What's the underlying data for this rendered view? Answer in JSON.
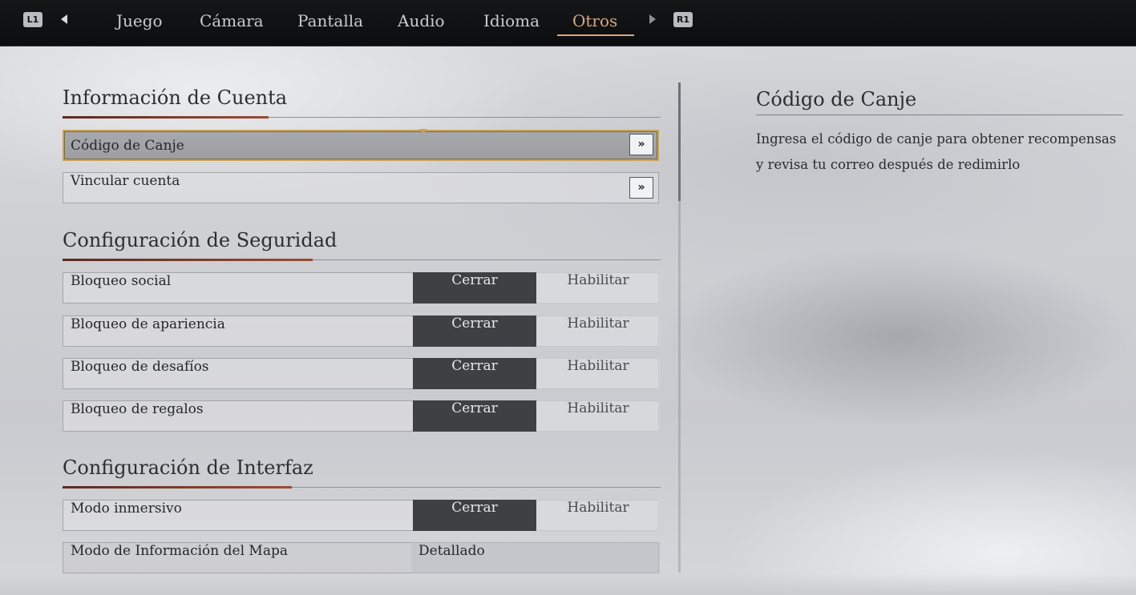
{
  "nav": {
    "left_button": "L1",
    "right_button": "R1",
    "tabs": [
      {
        "label": "Juego"
      },
      {
        "label": "Cámara"
      },
      {
        "label": "Pantalla"
      },
      {
        "label": "Audio"
      },
      {
        "label": "Idioma"
      },
      {
        "label": "Otros",
        "active": true
      }
    ],
    "active_color": "#d8a782"
  },
  "sections": {
    "account": {
      "title": "Información de Cuenta",
      "items": [
        {
          "label": "Código de Canje",
          "action_icon": "double-chevron-right-icon",
          "selected": true
        },
        {
          "label": "Vincular cuenta",
          "action_icon": "double-chevron-right-icon"
        }
      ]
    },
    "security": {
      "title": "Configuración de Seguridad",
      "items": [
        {
          "label": "Bloqueo social",
          "on_label": "Cerrar",
          "off_label": "Habilitar",
          "value": "Cerrar"
        },
        {
          "label": "Bloqueo de apariencia",
          "on_label": "Cerrar",
          "off_label": "Habilitar",
          "value": "Cerrar"
        },
        {
          "label": "Bloqueo de desafíos",
          "on_label": "Cerrar",
          "off_label": "Habilitar",
          "value": "Cerrar"
        },
        {
          "label": "Bloqueo de regalos",
          "on_label": "Cerrar",
          "off_label": "Habilitar",
          "value": "Cerrar"
        }
      ]
    },
    "interface": {
      "title": "Configuración de Interfaz",
      "items": [
        {
          "label": "Modo inmersivo",
          "on_label": "Cerrar",
          "off_label": "Habilitar",
          "value": "Cerrar"
        },
        {
          "label": "Modo de Información del Mapa",
          "value": "Detallado"
        }
      ]
    }
  },
  "detail": {
    "title": "Código de Canje",
    "description": "Ingresa el código de canje para obtener recompensas y revisa tu correo después de redimirlo"
  },
  "go_label": "»",
  "accent_color": "#c9a35a"
}
